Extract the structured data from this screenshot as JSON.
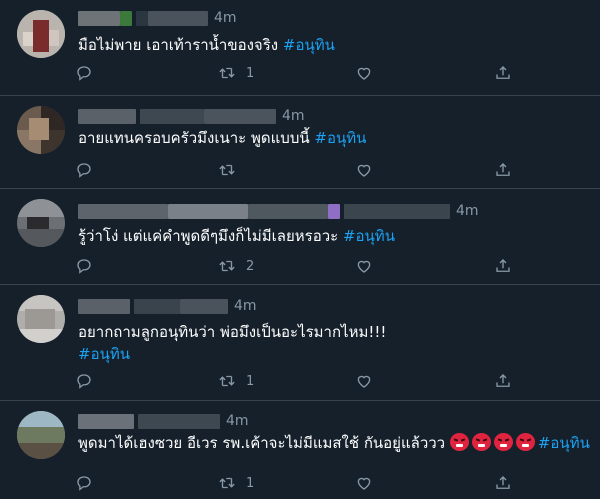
{
  "tweets": [
    {
      "time": "4m",
      "text": "มือไม่พาย เอาเท้าราน้ำของจริง ",
      "hashtag": "#อนุทิน",
      "text_line2": "",
      "retweets": "1",
      "replies": "",
      "likes": ""
    },
    {
      "time": "4m",
      "text": "อายแทนครอบครัวมึงเนาะ พูดแบบนี้ ",
      "hashtag": "#อนุทิน",
      "text_line2": "",
      "retweets": "",
      "replies": "",
      "likes": ""
    },
    {
      "time": "4m",
      "text": "รู้ว่าโง่ แต่แค่คำพูดดีๆมึงก็ไม่มีเลยหรอวะ ",
      "hashtag": "#อนุทิน",
      "text_line2": "",
      "retweets": "2",
      "replies": "",
      "likes": ""
    },
    {
      "time": "4m",
      "text": "อยากถามลูกอนุทินว่า พ่อมึงเป็นอะไรมากไหม!!!",
      "hashtag": "",
      "text_line2": "#อนุทิน",
      "retweets": "1",
      "replies": "",
      "likes": ""
    },
    {
      "time": "4m",
      "text": "พูดมาได้เฮงซวย อีเวร รพ.เค้าจะไม่มีแมสใช้ กันอยู่แล้ววว ",
      "hashtag": "#อนุทิน",
      "text_line2": "",
      "retweets": "1",
      "replies": "",
      "likes": ""
    }
  ],
  "icons": {
    "reply": "reply-icon",
    "retweet": "retweet-icon",
    "like": "heart-icon",
    "share": "share-icon",
    "emoji": "angry-face-emoji"
  },
  "colors": {
    "background": "#15202b",
    "divider": "#38444d",
    "text": "#ffffff",
    "secondary": "#8899a6",
    "hashtag": "#1da1f2"
  }
}
